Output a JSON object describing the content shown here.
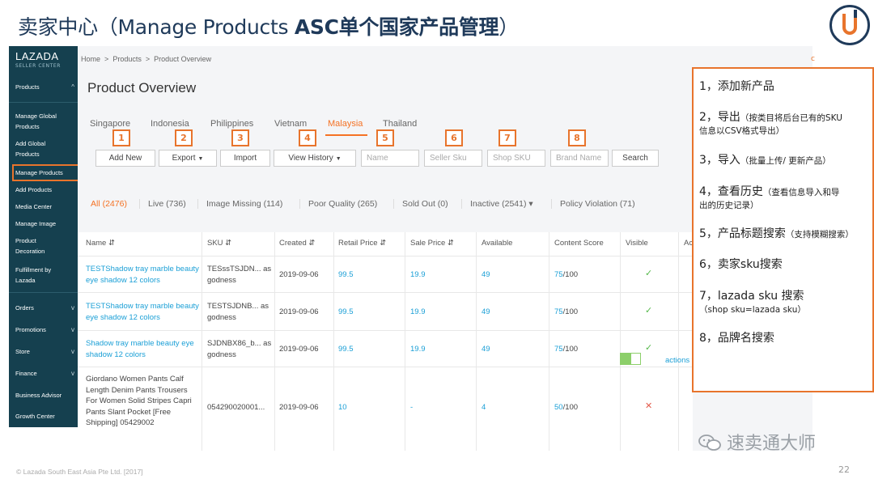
{
  "slide": {
    "title_prefix": "卖家中心（Manage Products ",
    "title_bold": "ASC单个国家产品管理",
    "title_suffix": "）",
    "footer": "© Lazada South East Asia Pte Ltd. [2017]",
    "page_number": "22",
    "watermark": "速卖通大师"
  },
  "sidebar": {
    "brand": "LAZADA",
    "brand_sub": "SELLER CENTER",
    "items": [
      {
        "label": "Products",
        "arrow": "^"
      },
      {
        "label": "Manage Global Products"
      },
      {
        "label": "Add Global Products"
      },
      {
        "label": "Manage Products"
      },
      {
        "label": "Add Products"
      },
      {
        "label": "Media Center"
      },
      {
        "label": "Manage Image"
      },
      {
        "label": "Product Decoration"
      },
      {
        "label": "Fulfillment by Lazada"
      },
      {
        "label": "Orders",
        "arrow": "v"
      },
      {
        "label": "Promotions",
        "arrow": "v"
      },
      {
        "label": "Store",
        "arrow": "v"
      },
      {
        "label": "Finance",
        "arrow": "v"
      },
      {
        "label": "Business Advisor"
      },
      {
        "label": "Growth Center"
      }
    ]
  },
  "breadcrumb": {
    "home": "Home",
    "products": "Products",
    "current": "Product Overview",
    "sep": ">"
  },
  "page_title": "Product Overview",
  "countries": [
    "Singapore",
    "Indonesia",
    "Philippines",
    "Vietnam",
    "Malaysia",
    "Thailand"
  ],
  "active_country": "Malaysia",
  "numbers": [
    "1",
    "2",
    "3",
    "4",
    "5",
    "6",
    "7",
    "8"
  ],
  "toolbar": {
    "add_new": "Add New",
    "export": "Export",
    "import": "Import",
    "view_history": "View History",
    "name_placeholder": "Name",
    "seller_sku_placeholder": "Seller Sku",
    "shop_sku_placeholder": "Shop SKU",
    "brand_placeholder": "Brand Name",
    "search": "Search"
  },
  "filters": [
    {
      "label": "All (2476)",
      "active": true
    },
    {
      "label": "Live (736)"
    },
    {
      "label": "Image Missing (114)"
    },
    {
      "label": "Poor Quality (265)"
    },
    {
      "label": "Sold Out (0)"
    },
    {
      "label": "Inactive (2541) ▾"
    },
    {
      "label": "Policy Violation (71)"
    }
  ],
  "table": {
    "headers": [
      "Name ⇵",
      "SKU ⇵",
      "Created ⇵",
      "Retail Price ⇵",
      "Sale Price ⇵",
      "Available",
      "Content Score",
      "Visible",
      "Ac"
    ],
    "rows": [
      {
        "name": "TESTShadow tray marble beauty eye shadow 12 colors",
        "sku": "TESssTSJDN... as godness",
        "created": "2019-09-06",
        "retail": "99.5",
        "sale": "19.9",
        "available": "49",
        "score_a": "75",
        "score_b": "/100",
        "visible": "✓"
      },
      {
        "name": "TESTShadow tray marble beauty eye shadow 12 colors",
        "sku": "TESTSJDNB... as godness",
        "created": "2019-09-06",
        "retail": "99.5",
        "sale": "19.9",
        "available": "49",
        "score_a": "75",
        "score_b": "/100",
        "visible": "✓"
      },
      {
        "name": "Shadow tray marble beauty eye shadow 12 colors",
        "sku": "SJDNBX86_b... as godness",
        "created": "2019-09-06",
        "retail": "99.5",
        "sale": "19.9",
        "available": "49",
        "score_a": "75",
        "score_b": "/100",
        "visible": "✓"
      },
      {
        "name": "Giordano Women Pants Calf Length Denim Pants Trousers For Women Solid Stripes Capri Pants Slant Pocket [Free Shipping] 05429002",
        "sku": "054290020001...",
        "created": "2019-09-06",
        "retail": "10",
        "sale": "-",
        "available": "4",
        "score_a": "50",
        "score_b": "/100",
        "visible": "✕"
      }
    ],
    "actions_label": "actions ▾"
  },
  "annotations": [
    {
      "main": "1，添加新产品",
      "note": ""
    },
    {
      "main": "2，导出",
      "note": "（按类目将后台已有的SKU",
      "note2": "信息以CSV格式导出）"
    },
    {
      "main": "3，导入",
      "note": "（批量上传/ 更新产品）"
    },
    {
      "main": "4，查看历史",
      "note": "（查看信息导入和导",
      "note2": "出的历史记录）"
    },
    {
      "main": "5，产品标题搜索",
      "note": "（支持模糊搜索）"
    },
    {
      "main": "6，卖家sku搜索",
      "note": ""
    },
    {
      "main": "7，lazada sku 搜索",
      "note": "",
      "note2": "（shop sku=lazada sku）"
    },
    {
      "main": "8，品牌名搜索",
      "note": ""
    }
  ],
  "colors": {
    "accent": "#e8742c",
    "lazada_orange": "#f57224",
    "sidebar": "#15404f",
    "link": "#1a9fd6",
    "check": "#55b84a",
    "cross": "#e35a4b"
  }
}
